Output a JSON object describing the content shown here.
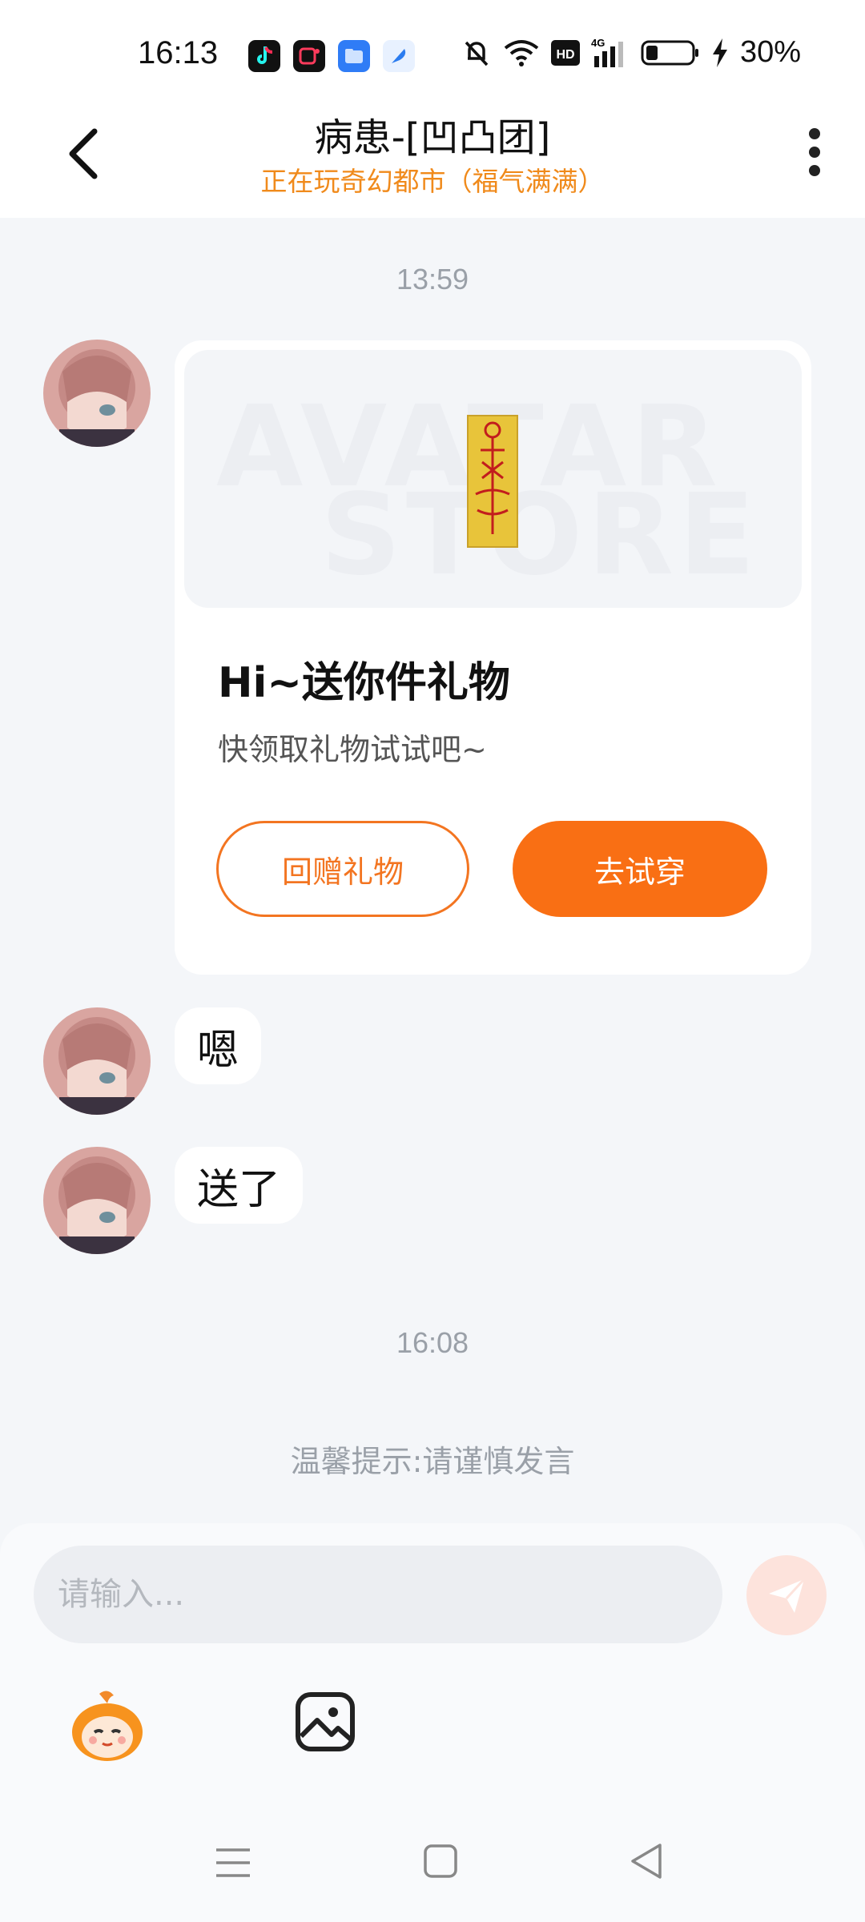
{
  "status_bar": {
    "time": "16:13",
    "battery_percent": "30%",
    "app_icons": [
      "tiktok-icon",
      "screen-recorder-icon",
      "files-icon",
      "feather-app-icon"
    ],
    "system_icons": [
      "mute-icon",
      "wifi-icon",
      "hd-icon",
      "signal-4g-icon",
      "battery-icon",
      "charging-icon"
    ]
  },
  "header": {
    "title": "病患-[凹凸团]",
    "subtitle": "正在玩奇幻都市（福气满满）",
    "subtitle_color": "#f08a1b"
  },
  "messages": {
    "timestamp_1": "13:59",
    "gift_card": {
      "watermark_line1": "AVATAR",
      "watermark_line2": "STORE",
      "title": "Hi~送你件礼物",
      "subtitle": "快领取礼物试试吧~",
      "return_gift_label": "回赠礼物",
      "try_on_label": "去试穿",
      "accent_color": "#f96f14"
    },
    "bubble_1": "嗯",
    "bubble_2": "送了",
    "timestamp_2": "16:08",
    "tip": "温馨提示:请谨慎发言"
  },
  "composer": {
    "placeholder": "请输入..."
  },
  "nav_bar": {
    "icons": [
      "menu-icon",
      "home-icon",
      "back-triangle-icon"
    ]
  }
}
